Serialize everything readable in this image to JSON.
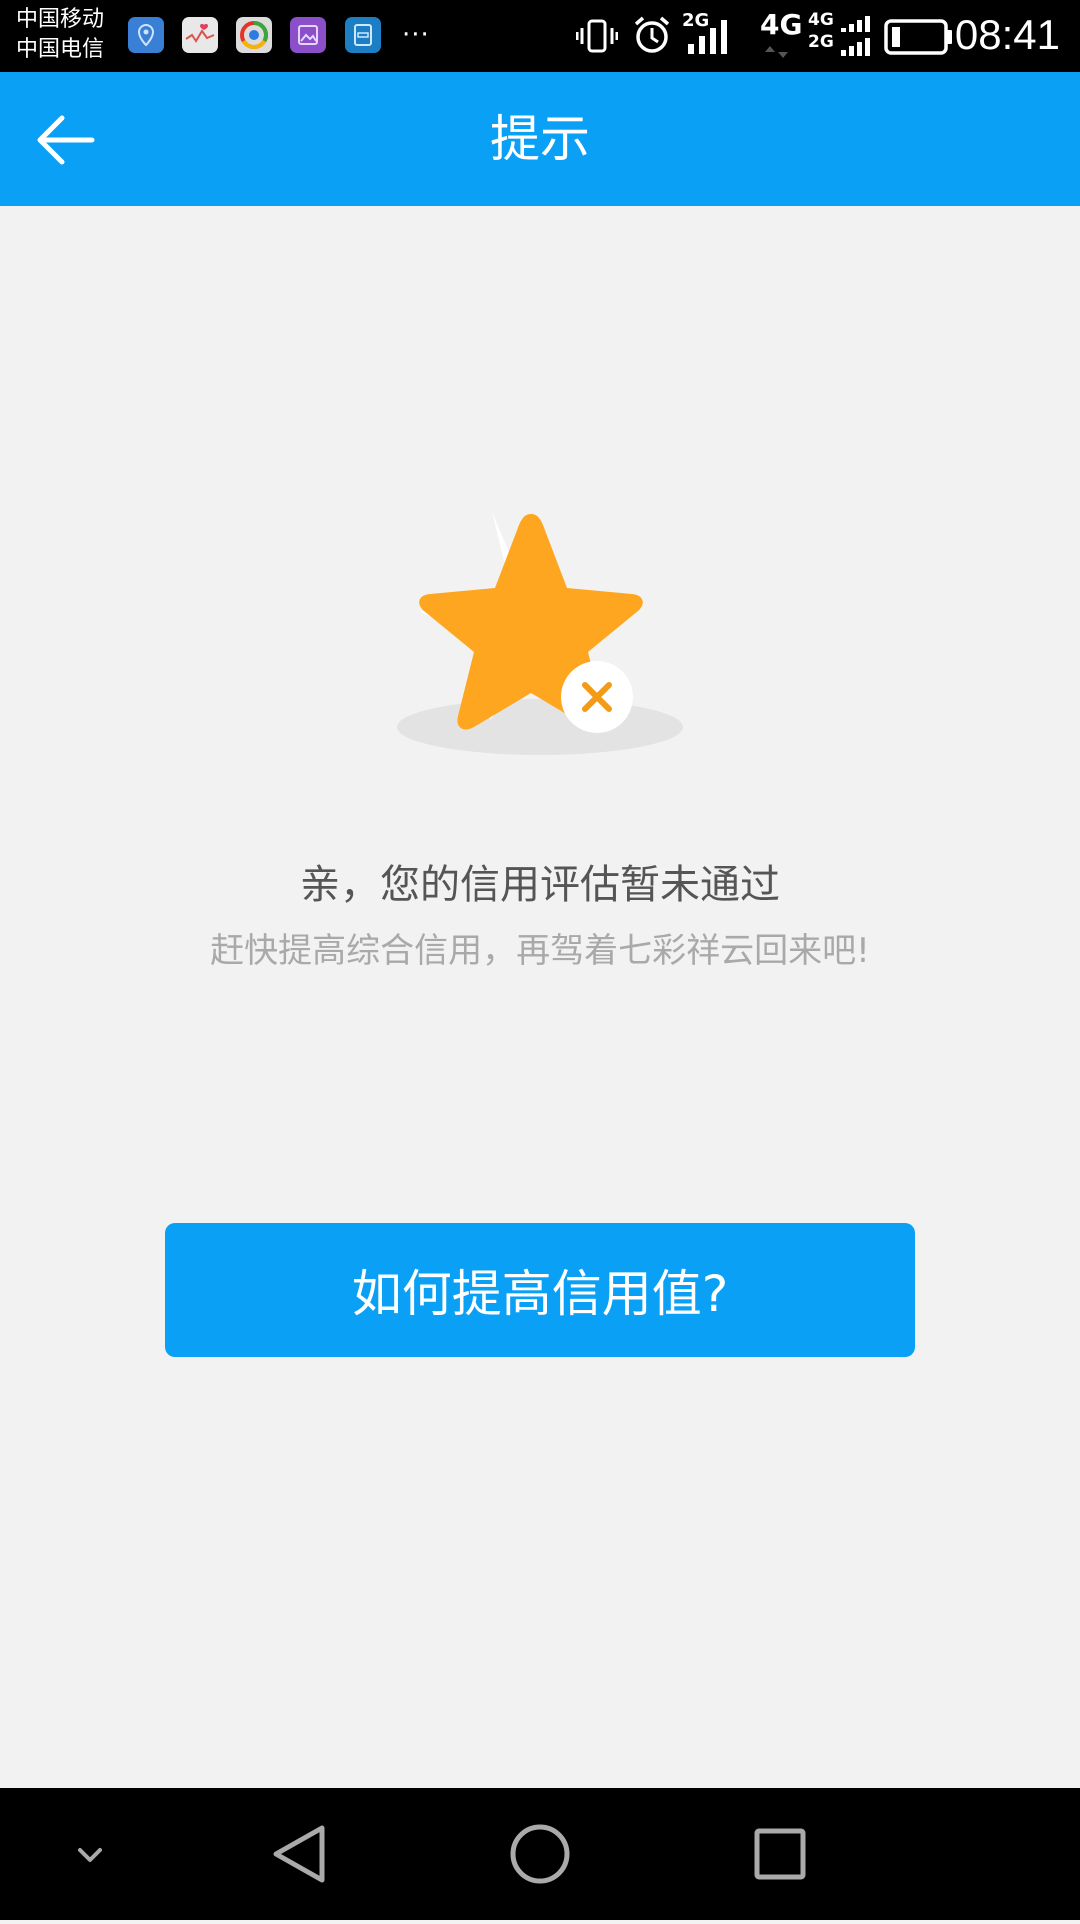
{
  "status_bar": {
    "carrier_1": "中国移动",
    "carrier_2": "中国电信",
    "network_1": "2G",
    "network_2": "4G",
    "network_3a": "4G",
    "network_3b": "2G",
    "time": "08:41",
    "notification_icons": [
      "location-app-icon",
      "health-app-icon",
      "browser-app-icon",
      "gallery-app-icon",
      "storage-app-icon"
    ]
  },
  "app_bar": {
    "title": "提示"
  },
  "content": {
    "message_main": "亲，您的信用评估暂未通过",
    "message_sub": "赶快提高综合信用，再驾着七彩祥云回来吧!",
    "cta_label": "如何提高信用值?"
  },
  "colors": {
    "primary": "#0aa0f5",
    "star": "#ffa620",
    "background": "#f2f2f2"
  }
}
